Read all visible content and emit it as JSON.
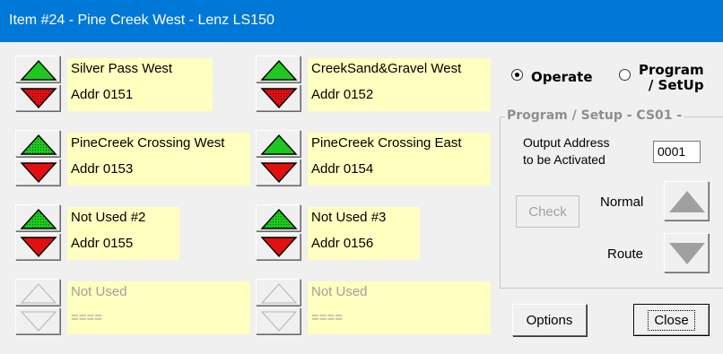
{
  "window": {
    "title": "Item #24 - Pine Creek West - Lenz LS150"
  },
  "turnouts": [
    {
      "name": "Silver Pass West",
      "addr": "Addr 0151",
      "up": "solid-green",
      "down": "dotted-red"
    },
    {
      "name": "CreekSand&Gravel West",
      "addr": "Addr 0152",
      "up": "solid-green",
      "down": "dotted-red"
    },
    {
      "name": "PineCreek Crossing West",
      "addr": "Addr 0153",
      "up": "dotted-green",
      "down": "solid-red"
    },
    {
      "name": "PineCreek Crossing East",
      "addr": "Addr 0154",
      "up": "solid-green",
      "down": "solid-red"
    },
    {
      "name": "Not Used #2",
      "addr": "Addr 0155",
      "up": "dotted-green",
      "down": "solid-red"
    },
    {
      "name": "Not Used #3",
      "addr": "Addr 0156",
      "up": "dotted-green",
      "down": "solid-red"
    },
    {
      "name": "Not Used",
      "addr": "====",
      "up": "outline",
      "down": "outline"
    },
    {
      "name": "Not Used",
      "addr": "====",
      "up": "outline",
      "down": "outline"
    }
  ],
  "mode": {
    "operate_label": "Operate",
    "program_label_line1": "Program",
    "program_label_line2": "/ SetUp",
    "selected": "operate"
  },
  "program_setup": {
    "group_title": "Program / Setup  - CS01 -",
    "output_label_line1": "Output Address",
    "output_label_line2": "to be Activated",
    "output_address": "0001",
    "check_label": "Check",
    "normal_label": "Normal",
    "route_label": "Route"
  },
  "buttons": {
    "options": "Options",
    "close": "Close"
  },
  "colors": {
    "title_bar": "#0078d7",
    "label_bg": "#ffffc0",
    "green": "#1ec81e",
    "red": "#e01010",
    "disabled_text": "#a0a0a0"
  },
  "icons": [
    "arrow-up-green-icon",
    "arrow-down-red-icon",
    "arrow-up-gray-icon",
    "arrow-down-gray-icon",
    "radio-icon"
  ]
}
